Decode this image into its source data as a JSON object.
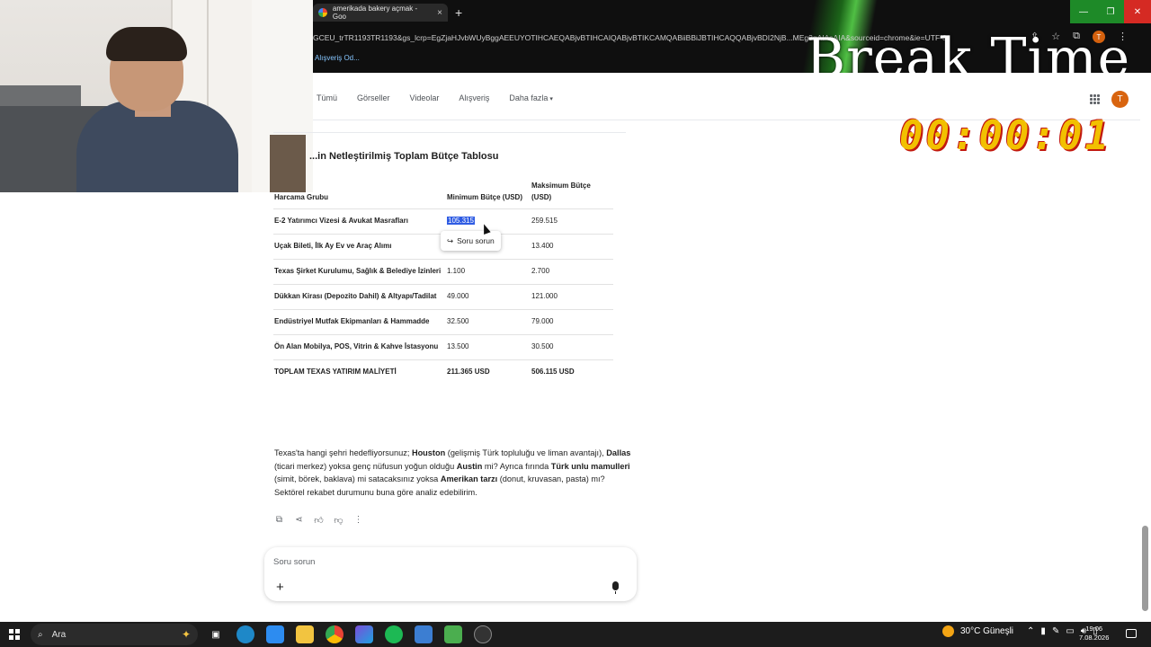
{
  "browser": {
    "tab_title": "amerikada bakery açmak - Goo",
    "tab_close": "×",
    "new_tab": "+",
    "url": "GCEU_trTR1193TR1193&gs_lcrp=EgZjaHJvbWUyBggAEEUYOTIHCAEQABjvBTIHCAIQABjvBTIKCAMQABiiBBiJBTIHCAQQABjvBDI2NjB...MEg3gAIAsAIA&sourceid=chrome&ie=UTF-8",
    "bookmark": "Alışveriş Od...",
    "window_controls": [
      "—",
      "❐",
      "✕"
    ],
    "avatar_letter": "T"
  },
  "overlay": {
    "title": "Break Time",
    "timer": "00:00:01"
  },
  "google": {
    "nav": [
      "Tümü",
      "Görseller",
      "Videolar",
      "Alışveriş",
      "Daha fazla"
    ],
    "avatar_letter": "T"
  },
  "content": {
    "section_title": "...in Netleştirilmiş Toplam Bütçe Tablosu",
    "table": {
      "headers": [
        "Harcama Grubu",
        "Minimum Bütçe (USD)",
        "Maksimum Bütçe (USD)"
      ],
      "rows": [
        {
          "group": "E-2 Yatırımcı Vizesi & Avukat Masrafları",
          "min": "105.315",
          "max": "259.515"
        },
        {
          "group": "Uçak Bileti, İlk Ay Ev ve Araç Alımı",
          "min": "",
          "max": "13.400"
        },
        {
          "group": "Texas Şirket Kurulumu, Sağlık & Belediye İzinleri",
          "min": "1.100",
          "max": "2.700"
        },
        {
          "group": "Dükkan Kirası (Depozito Dahil) & Altyapı/Tadilat",
          "min": "49.000",
          "max": "121.000"
        },
        {
          "group": "Endüstriyel Mutfak Ekipmanları & Hammadde",
          "min": "32.500",
          "max": "79.000"
        },
        {
          "group": "Ön Alan Mobilya, POS, Vitrin & Kahve İstasyonu",
          "min": "13.500",
          "max": "30.500"
        }
      ],
      "total": {
        "group": "TOPLAM TEXAS YATIRIM MALİYETİ",
        "min": "211.365 USD",
        "max": "506.115 USD"
      }
    },
    "tooltip": "Soru sorun",
    "paragraph": {
      "p1": "Texas'ta hangi şehri hedefliyorsunuz; ",
      "b1": "Houston",
      "p2": " (gelişmiş Türk topluluğu ve liman avantajı), ",
      "b2": "Dallas",
      "p3": " (ticari merkez) yoksa genç nüfusun yoğun olduğu ",
      "b3": "Austin",
      "p4": " mi? Ayrıca fırında ",
      "b4": "Türk unlu mamulleri",
      "p5": " (simit, börek, baklava) mi satacaksınız yoksa ",
      "b5": "Amerikan tarzı",
      "p6": " (donut, kruvasan, pasta) mı? Sektörel rekabet durumunu buna göre analiz edebilirim."
    },
    "ask_placeholder": "Soru sorun"
  },
  "taskbar": {
    "search_label": "Ara",
    "weather": "30°C  Güneşli",
    "time": "19:06",
    "date": "7.08.2026"
  }
}
